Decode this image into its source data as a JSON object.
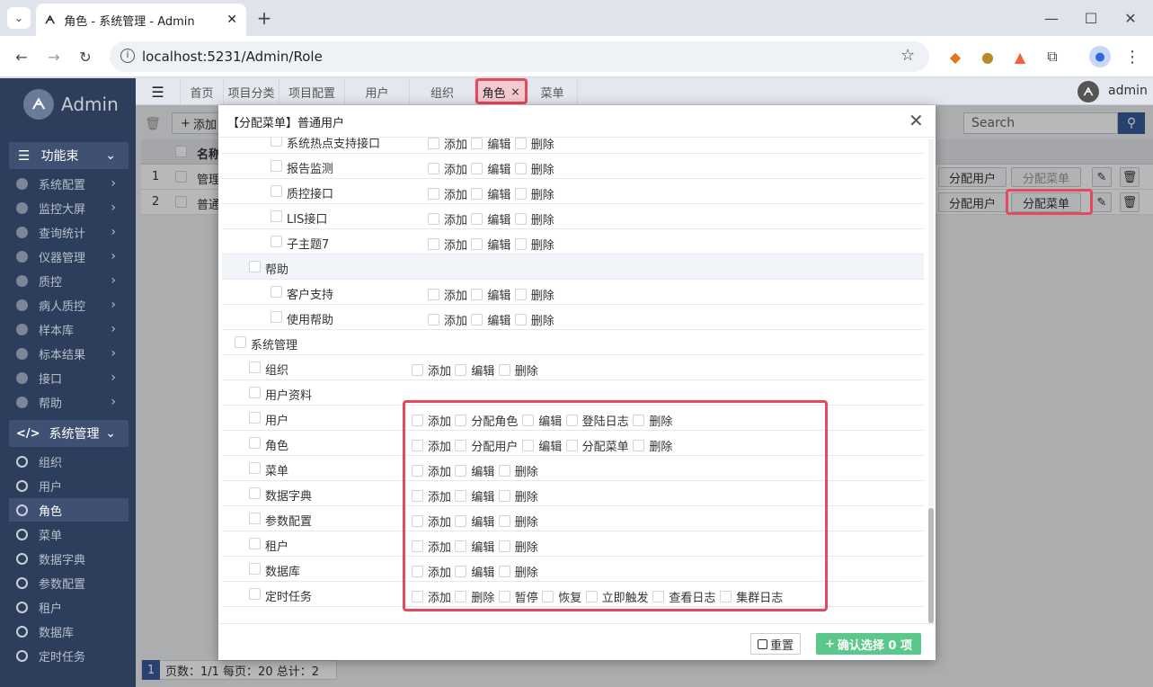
{
  "browser": {
    "tab_title": "角色 - 系统管理 - Admin",
    "url": "localhost:5231/Admin/Role"
  },
  "sidebar": {
    "brand": "Admin",
    "group1": "功能束",
    "group1_items": [
      "系统配置",
      "监控大屏",
      "查询统计",
      "仪器管理",
      "质控",
      "病人质控",
      "样本库",
      "标本结果",
      "接口",
      "帮助"
    ],
    "group2": "系统管理",
    "group2_items": [
      "组织",
      "用户",
      "角色",
      "菜单",
      "数据字典",
      "参数配置",
      "租户",
      "数据库",
      "定时任务"
    ],
    "active": "角色"
  },
  "apptabs": [
    "首页",
    "项目分类",
    "项目配置",
    "用户",
    "组织",
    "角色",
    "菜单"
  ],
  "active_tab": "角色",
  "user": "admin",
  "search_placeholder": "Search",
  "toolbar": {
    "add_label": "添加"
  },
  "table": {
    "header_name": "名称",
    "rows": [
      {
        "no": "1",
        "name": "管理"
      },
      {
        "no": "2",
        "name": "普通"
      }
    ],
    "assign_user": "分配用户",
    "assign_menu": "分配菜单"
  },
  "pager": {
    "page_no": "1",
    "text": "页数：1/1 每页：20 总计：2"
  },
  "dialog": {
    "title": "【分配菜单】普通用户",
    "reset_label": "重置",
    "confirm_label": "确认选择 0 项",
    "rows": [
      {
        "level": 2,
        "name": "系统热点支持接口",
        "perms": [
          "添加",
          "编辑",
          "删除"
        ]
      },
      {
        "level": 2,
        "name": "报告监测",
        "perms": [
          "添加",
          "编辑",
          "删除"
        ]
      },
      {
        "level": 2,
        "name": "质控接口",
        "perms": [
          "添加",
          "编辑",
          "删除"
        ]
      },
      {
        "level": 2,
        "name": "LIS接口",
        "perms": [
          "添加",
          "编辑",
          "删除"
        ]
      },
      {
        "level": 2,
        "name": "子主题7",
        "perms": [
          "添加",
          "编辑",
          "删除"
        ]
      },
      {
        "level": 1,
        "name": "帮助",
        "perms": []
      },
      {
        "level": 2,
        "name": "客户支持",
        "perms": [
          "添加",
          "编辑",
          "删除"
        ]
      },
      {
        "level": 2,
        "name": "使用帮助",
        "perms": [
          "添加",
          "编辑",
          "删除"
        ]
      },
      {
        "level": 0,
        "name": "系统管理",
        "perms": []
      },
      {
        "level": 1,
        "name": "组织",
        "perms": [
          "添加",
          "编辑",
          "删除"
        ]
      },
      {
        "level": 1,
        "name": "用户资料",
        "perms": []
      },
      {
        "level": 1,
        "name": "用户",
        "perms": [
          "添加",
          "分配角色",
          "编辑",
          "登陆日志",
          "删除"
        ]
      },
      {
        "level": 1,
        "name": "角色",
        "perms": [
          "添加",
          "分配用户",
          "编辑",
          "分配菜单",
          "删除"
        ]
      },
      {
        "level": 1,
        "name": "菜单",
        "perms": [
          "添加",
          "编辑",
          "删除"
        ]
      },
      {
        "level": 1,
        "name": "数据字典",
        "perms": [
          "添加",
          "编辑",
          "删除"
        ]
      },
      {
        "level": 1,
        "name": "参数配置",
        "perms": [
          "添加",
          "编辑",
          "删除"
        ]
      },
      {
        "level": 1,
        "name": "租户",
        "perms": [
          "添加",
          "编辑",
          "删除"
        ]
      },
      {
        "level": 1,
        "name": "数据库",
        "perms": [
          "添加",
          "编辑",
          "删除"
        ]
      },
      {
        "level": 1,
        "name": "定时任务",
        "perms": [
          "添加",
          "删除",
          "暂停",
          "恢复",
          "立即触发",
          "查看日志",
          "集群日志"
        ]
      }
    ]
  }
}
